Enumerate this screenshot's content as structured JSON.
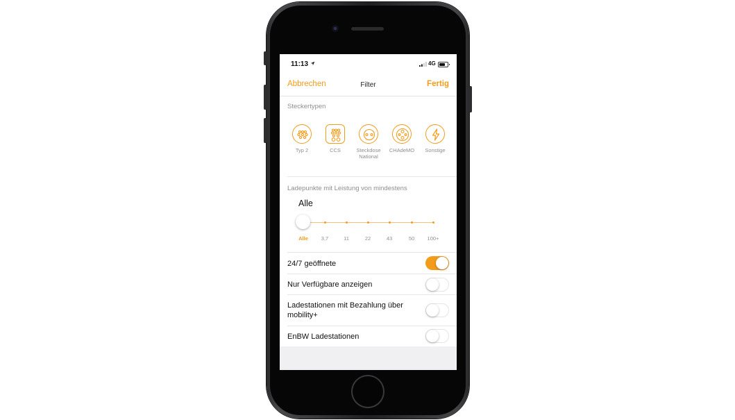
{
  "status_bar": {
    "time": "11:13",
    "network": "4G"
  },
  "nav": {
    "left": "Abbrechen",
    "title": "Filter",
    "right": "Fertig"
  },
  "connectors": {
    "heading": "Steckertypen",
    "items": [
      {
        "label": "Typ 2",
        "icon": "typ2-plug-icon"
      },
      {
        "label": "CCS",
        "icon": "ccs-plug-icon"
      },
      {
        "label": "Steckdose National",
        "icon": "household-socket-icon"
      },
      {
        "label": "CHAdeMO",
        "icon": "chademo-plug-icon"
      },
      {
        "label": "Sonstige",
        "icon": "lightning-icon"
      }
    ]
  },
  "power": {
    "heading": "Ladepunkte mit Leistung von mindestens",
    "current": "Alle",
    "ticks": [
      "Alle",
      "3,7",
      "11",
      "22",
      "43",
      "50",
      "100+"
    ],
    "selected_index": 0
  },
  "toggles": [
    {
      "label": "24/7 geöffnete",
      "on": true
    },
    {
      "label": "Nur Verfügbare anzeigen",
      "on": false
    },
    {
      "label": "Ladestationen mit Bezahlung über mobility+",
      "on": false
    },
    {
      "label": "EnBW Ladestationen",
      "on": false
    }
  ],
  "colors": {
    "accent": "#f39b1b",
    "secondary_text": "#8e8e93",
    "background": "#f0f0f3"
  }
}
